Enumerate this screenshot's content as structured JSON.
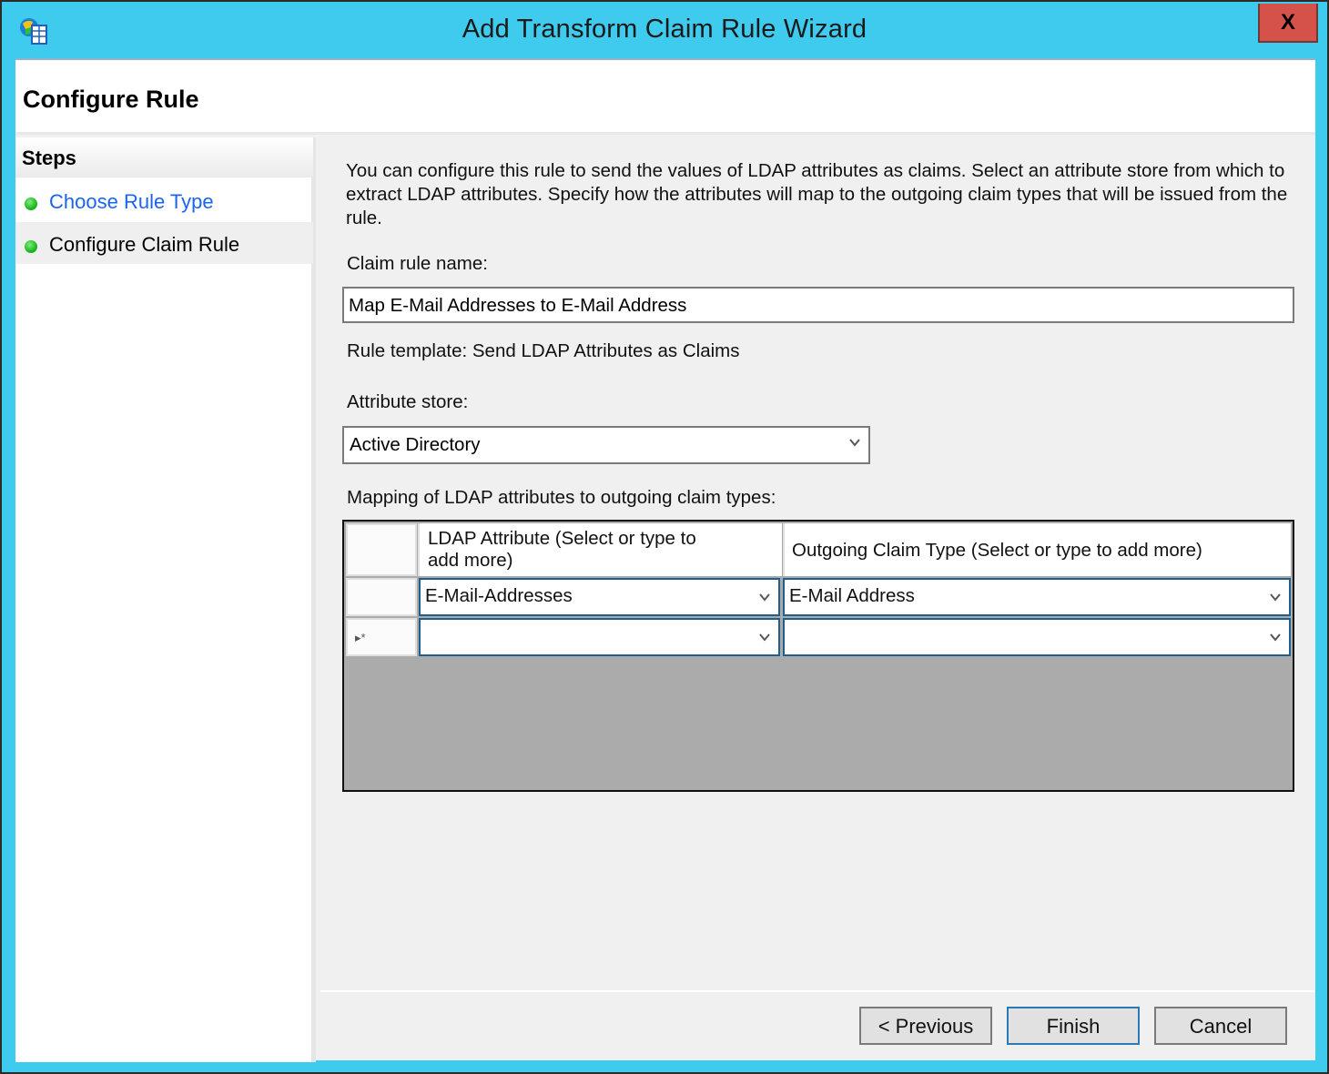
{
  "window": {
    "title": "Add Transform Claim Rule Wizard",
    "close_label": "X",
    "app_icon": "adfs-globe-server-icon",
    "colors": {
      "titlebar": "#3ecbee",
      "close": "#d4524a",
      "link": "#1a64f0",
      "step_done": "#1fb81f"
    }
  },
  "header": {
    "title": "Configure Rule"
  },
  "steps": {
    "heading": "Steps",
    "items": [
      {
        "label": "Choose Rule Type",
        "status": "complete",
        "is_link": true
      },
      {
        "label": "Configure Claim Rule",
        "status": "current",
        "is_link": false
      }
    ]
  },
  "form": {
    "description": "You can configure this rule to send the values of LDAP attributes as claims. Select an attribute store from which to extract LDAP attributes. Specify how the attributes will map to the outgoing claim types that will be issued from the rule.",
    "claim_rule_name_label": "Claim rule name:",
    "claim_rule_name_value": "Map E-Mail Addresses to E-Mail Address",
    "rule_template_text": "Rule template: Send LDAP Attributes as Claims",
    "attribute_store_label": "Attribute store:",
    "attribute_store_value": "Active Directory",
    "mapping_label": "Mapping of LDAP attributes to outgoing claim types:"
  },
  "mapping_grid": {
    "columns": [
      "LDAP Attribute (Select or type to add more)",
      "Outgoing Claim Type (Select or type to add more)"
    ],
    "rows": [
      {
        "marker": "",
        "ldap_attribute": "E-Mail-Addresses",
        "claim_type": "E-Mail Address"
      },
      {
        "marker": "▸*",
        "ldap_attribute": "",
        "claim_type": ""
      }
    ]
  },
  "buttons": {
    "previous": "< Previous",
    "finish": "Finish",
    "cancel": "Cancel"
  }
}
